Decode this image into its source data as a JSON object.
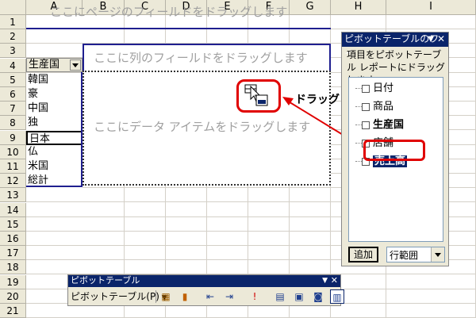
{
  "columns": [
    "A",
    "B",
    "C",
    "D",
    "E",
    "F",
    "G",
    "H",
    "I"
  ],
  "rows": [
    "1",
    "2",
    "3",
    "4",
    "5",
    "6",
    "7",
    "8",
    "9",
    "10",
    "11",
    "12",
    "13",
    "14",
    "15",
    "16",
    "17",
    "18",
    "19",
    "20",
    "21"
  ],
  "page_field_hint": "ここにページのフィールドをドラッグします",
  "column_field_hint": "ここに列のフィールドをドラッグします",
  "data_item_hint": "ここにデータ アイテムをドラッグします",
  "row_field": {
    "label": "生産国",
    "dropdown_icon": "dropdown-arrow"
  },
  "row_items": [
    "韓国",
    "豪",
    "中国",
    "独",
    "日本",
    "仏",
    "米国",
    "総計"
  ],
  "annotation": "ドラッグ",
  "field_list_panel": {
    "title": "ピボットテーブルのフィ",
    "instruction": "項目をピボットテーブル レポートにドラッグします",
    "fields": [
      "日付",
      "商品",
      "生産国",
      "店舗",
      "売上高"
    ],
    "add_button": "追加",
    "area_select": "行範囲"
  },
  "pivot_toolbar": {
    "title": "ピボットテーブル",
    "menu_label": "ピボットテーブル(P)",
    "icons": [
      "format-report-icon",
      "chart-wizard-icon",
      "hide-detail-icon",
      "show-detail-icon",
      "refresh-icon",
      "include-hidden-icon",
      "always-display-items-icon",
      "field-settings-icon",
      "field-list-icon"
    ]
  },
  "colors": {
    "highlight": "#e00000",
    "titlebar": "#0a246a",
    "selection": "#0a246a"
  }
}
